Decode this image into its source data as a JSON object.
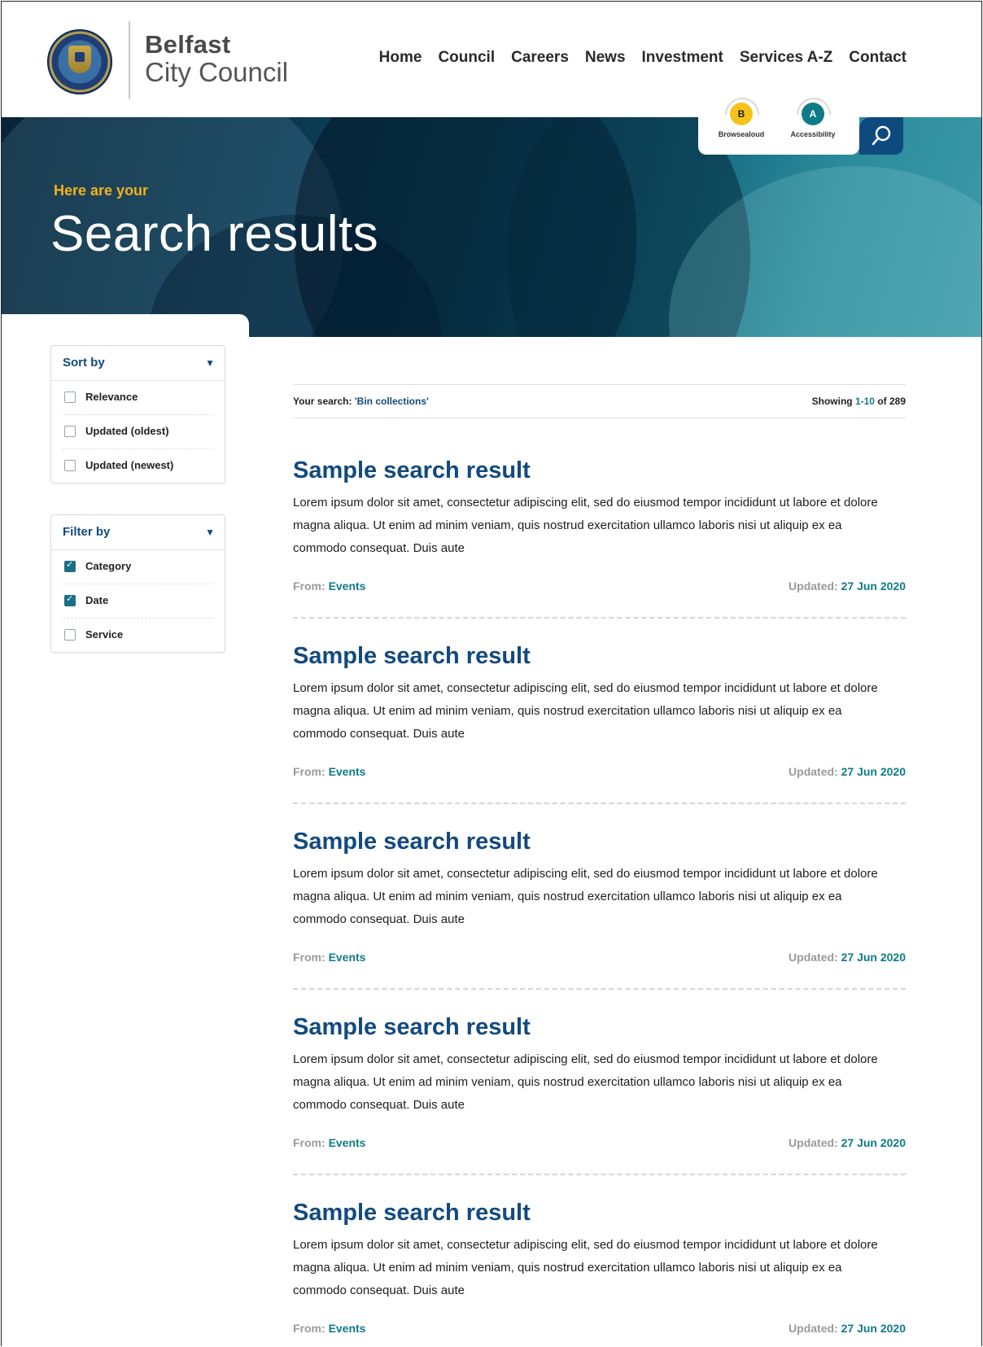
{
  "header": {
    "logo_line1": "Belfast",
    "logo_line2": "City Council",
    "nav": [
      "Home",
      "Council",
      "Careers",
      "News",
      "Investment",
      "Services A-Z",
      "Contact"
    ]
  },
  "tools": {
    "browsealoud": {
      "badge": "B",
      "label": "Browsealoud"
    },
    "accessibility": {
      "badge": "A",
      "label": "Accessibility"
    }
  },
  "hero": {
    "kicker": "Here are your",
    "title": "Search results"
  },
  "sidebar": {
    "sort": {
      "title": "Sort by",
      "options": [
        {
          "label": "Relevance",
          "checked": false
        },
        {
          "label": "Updated (oldest)",
          "checked": false
        },
        {
          "label": "Updated (newest)",
          "checked": false
        }
      ]
    },
    "filter": {
      "title": "Filter by",
      "options": [
        {
          "label": "Category",
          "checked": true
        },
        {
          "label": "Date",
          "checked": true
        },
        {
          "label": "Service",
          "checked": false
        }
      ]
    }
  },
  "summary": {
    "your_search_label": "Your search: ",
    "query": "'Bin collections'",
    "showing_label": "Showing ",
    "range": "1-10",
    "of_label": " of 289"
  },
  "results": [
    {
      "title": "Sample search result",
      "description": "Lorem ipsum dolor sit amet, consectetur adipiscing elit, sed do eiusmod tempor incididunt ut labore et dolore magna aliqua. Ut enim ad minim veniam, quis nostrud exercitation ullamco laboris nisi ut aliquip ex ea commodo consequat. Duis aute",
      "from_label": "From: ",
      "from": "Events",
      "updated_label": "Updated: ",
      "updated": "27 Jun 2020"
    },
    {
      "title": "Sample search result",
      "description": "Lorem ipsum dolor sit amet, consectetur adipiscing elit, sed do eiusmod tempor incididunt ut labore et dolore magna aliqua. Ut enim ad minim veniam, quis nostrud exercitation ullamco laboris nisi ut aliquip ex ea commodo consequat. Duis aute",
      "from_label": "From: ",
      "from": "Events",
      "updated_label": "Updated: ",
      "updated": "27 Jun 2020"
    },
    {
      "title": "Sample search result",
      "description": "Lorem ipsum dolor sit amet, consectetur adipiscing elit, sed do eiusmod tempor incididunt ut labore et dolore magna aliqua. Ut enim ad minim veniam, quis nostrud exercitation ullamco laboris nisi ut aliquip ex ea commodo consequat. Duis aute",
      "from_label": "From: ",
      "from": "Events",
      "updated_label": "Updated: ",
      "updated": "27 Jun 2020"
    },
    {
      "title": "Sample search result",
      "description": "Lorem ipsum dolor sit amet, consectetur adipiscing elit, sed do eiusmod tempor incididunt ut labore et dolore magna aliqua. Ut enim ad minim veniam, quis nostrud exercitation ullamco laboris nisi ut aliquip ex ea commodo consequat. Duis aute",
      "from_label": "From: ",
      "from": "Events",
      "updated_label": "Updated: ",
      "updated": "27 Jun 2020"
    },
    {
      "title": "Sample search result",
      "description": "Lorem ipsum dolor sit amet, consectetur adipiscing elit, sed do eiusmod tempor incididunt ut labore et dolore magna aliqua. Ut enim ad minim veniam, quis nostrud exercitation ullamco laboris nisi ut aliquip ex ea commodo consequat. Duis aute",
      "from_label": "From: ",
      "from": "Events",
      "updated_label": "Updated: ",
      "updated": "27 Jun 2020"
    }
  ],
  "colors": {
    "brand_blue": "#124a7e",
    "accent_teal": "#0e7c86",
    "accent_yellow": "#f4b21b"
  }
}
